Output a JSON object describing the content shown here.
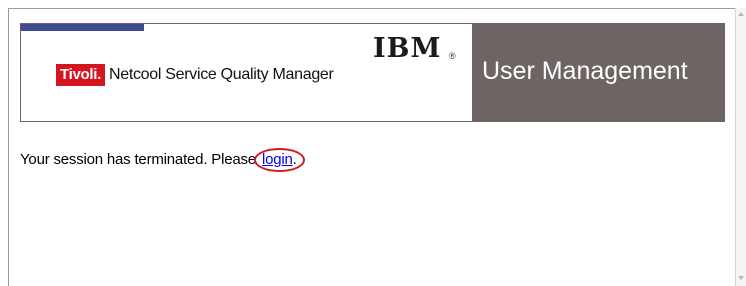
{
  "header": {
    "brand_badge": "Tivoli.",
    "product_name": "Netcool Service Quality Manager",
    "company_logo": "IBM",
    "registered_mark": "®",
    "section_title": "User Management"
  },
  "main": {
    "message_text": "Your session has terminated. Please",
    "login_link": "login",
    "trailing_punct": "."
  },
  "colors": {
    "banner_accent": "#3d4b8f",
    "brand_red": "#d6161f",
    "title_panel": "#6e6463",
    "highlight_ring": "#d21b22",
    "link": "#0000ee"
  }
}
